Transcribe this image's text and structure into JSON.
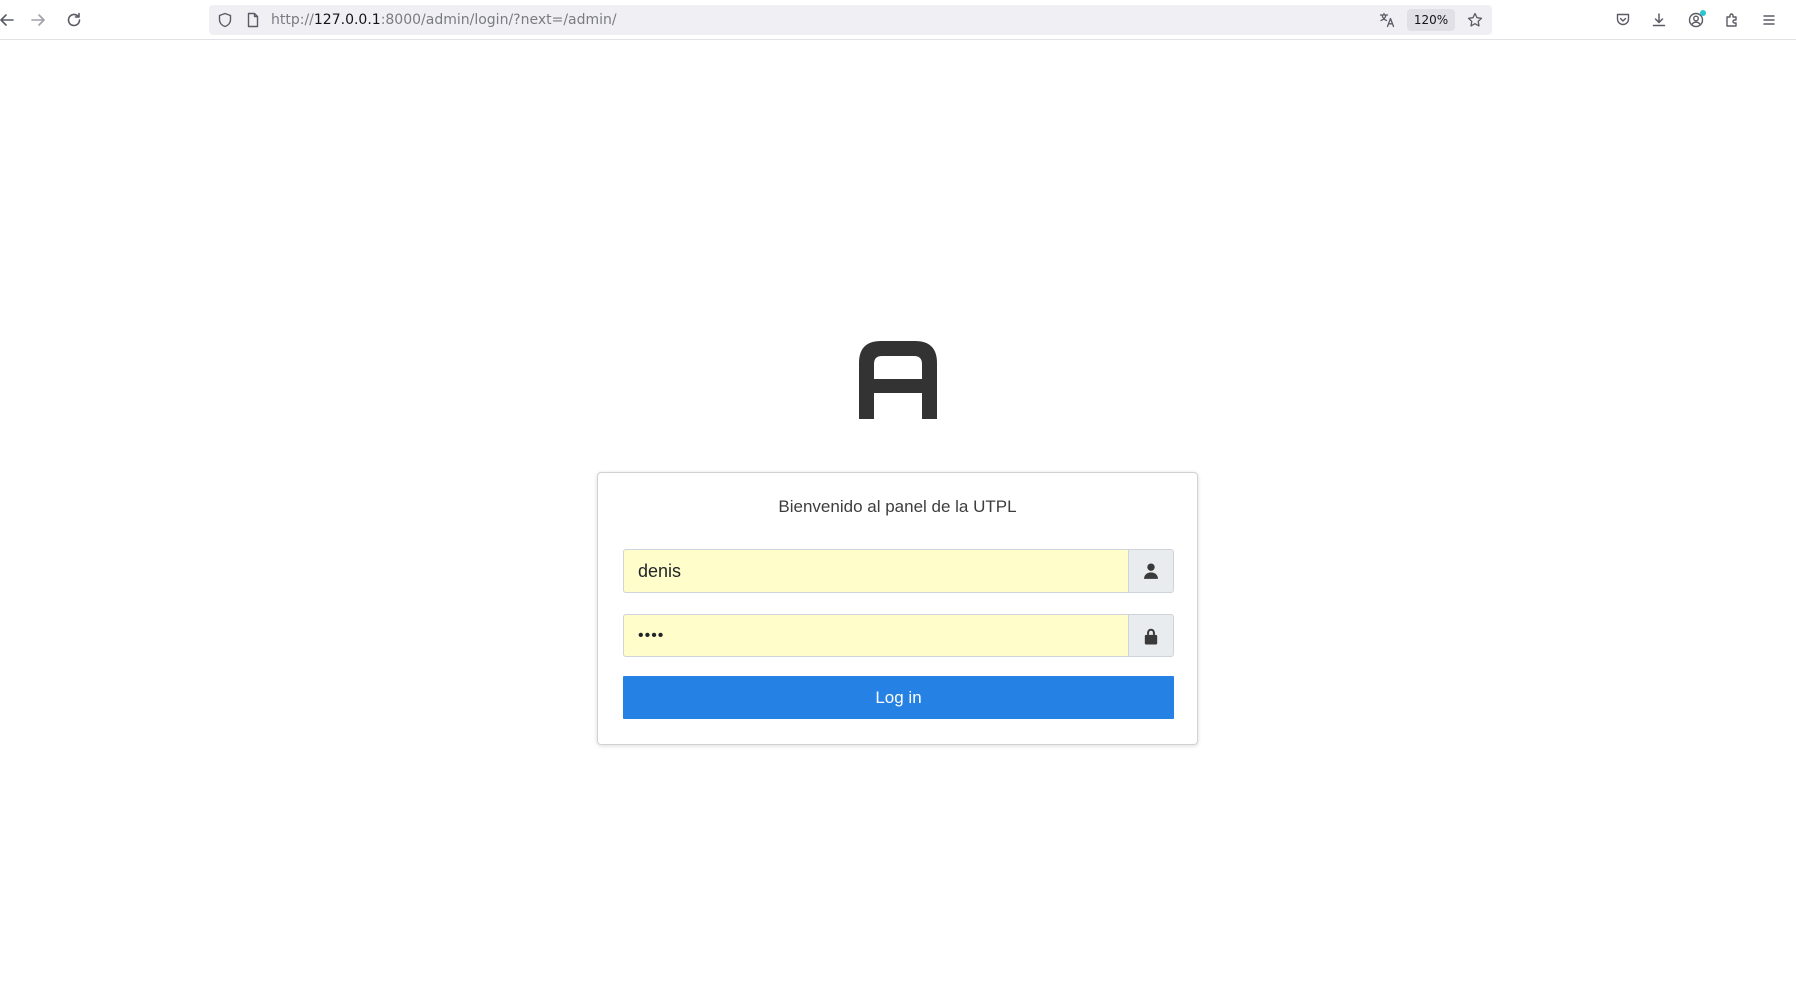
{
  "browser": {
    "url_prefix": "http://",
    "url_host": "127.0.0.1",
    "url_rest": ":8000/admin/login/?next=/admin/",
    "zoom": "120%",
    "icons": {
      "back": "back-arrow-icon",
      "forward": "forward-arrow-icon",
      "reload": "reload-icon",
      "tracking": "shield-icon",
      "page": "page-icon",
      "translate": "translate-icon",
      "bookmark": "star-icon",
      "pocket": "pocket-icon",
      "downloads": "download-icon",
      "account": "account-icon",
      "extensions": "puzzle-icon",
      "menu": "hamburger-menu-icon"
    }
  },
  "login": {
    "title": "Bienvenido al panel de la UTPL",
    "username_value": "denis",
    "password_value": "1234",
    "submit_label": "Log in",
    "icons": {
      "logo": "letter-a-logo",
      "user": "user-icon",
      "lock": "lock-icon"
    }
  },
  "colors": {
    "button": "#2581e3",
    "autofill": "#fffdc9",
    "addon": "#e9ecef",
    "logo": "#333333"
  }
}
